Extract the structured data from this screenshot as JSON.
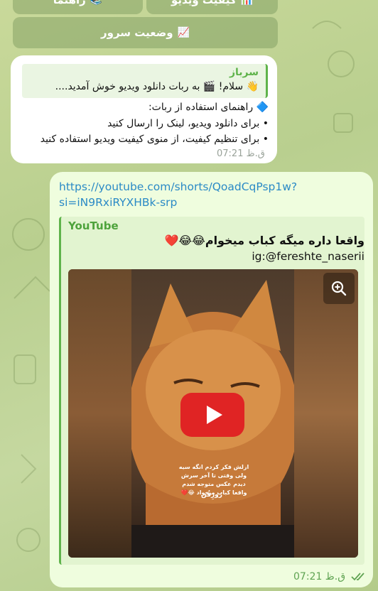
{
  "keyboard": {
    "top_left_label": "راهنما",
    "top_left_icon": "📚",
    "top_right_label": "کیفیت ویدیو",
    "top_right_icon": "📊",
    "server_label": "وضعیت سرور",
    "server_icon": "📈"
  },
  "incoming": {
    "quote_name": "سرباز",
    "quote_text": "👋 سلام! 🎬 به ربات دانلود ویدیو خوش آمدید....",
    "line1": "🔷 راهنمای استفاده از ربات:",
    "line2": "• برای دانلود ویدیو، لینک را ارسال کنید",
    "line3": "• برای تنظیم کیفیت، از منوی کیفیت ویدیو استفاده کنید",
    "time": "07:21 ق.ظ"
  },
  "outgoing": {
    "link_line1": "https://youtube.com/shorts/QoadCqPsp1w?",
    "link_line2": "si=iN9RxiRYXHBk-srp",
    "preview_site": "YouTube",
    "preview_title": "واقعا داره میگه کباب میخوام😂😂❤️",
    "preview_subtitle": "ig:@fereshte_naserii",
    "video_caption": "ازلش فکر کردم انگه سیه ولی وقتی تا آخر سرش دیدم عکس متوجه شدم واقعا کباب میخواد 😂❤️",
    "video_sign": "رُوزِقُن",
    "time": "07:21 ق.ظ"
  },
  "colors": {
    "accent_green": "#5fb34b",
    "link_blue": "#2b8ac6",
    "play_red": "#e02424"
  },
  "icons": [
    "zoom-in-icon",
    "play-icon",
    "double-check-icon"
  ]
}
